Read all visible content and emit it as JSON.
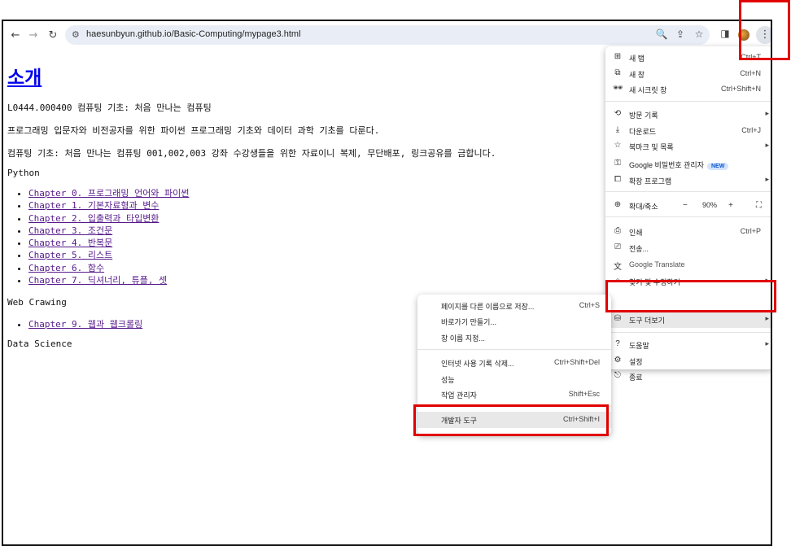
{
  "browser": {
    "url": "haesunbyun.github.io/Basic-Computing/mypage3.html",
    "icons": {
      "back": "←",
      "forward": "→",
      "reload": "↻",
      "site_info": "⚙",
      "zoom": "🔍",
      "share": "⇪",
      "bookmark": "☆",
      "side_panel": "◨",
      "menu": "⋮"
    }
  },
  "page": {
    "title": "소개",
    "lines": [
      "L0444.000400 컴퓨팅 기초: 처음 만나는 컴퓨팅",
      "프로그래밍 입문자와 비전공자를 위한 파이썬 프로그래밍 기초와 데이터 과학 기초를 다룬다.",
      "컴퓨팅 기초: 처음 만나는 컴퓨팅 001,002,003 강좌 수강생들을 위한 자료이니 복제, 무단배포, 링크공유를 금합니다."
    ],
    "sections": [
      {
        "heading": "Python",
        "links": [
          "Chapter 0. 프로그래밍 언어와 파이썬",
          "Chapter 1. 기본자료형과 변수",
          "Chapter 2. 입출력과 타입변환",
          "Chapter 3. 조건문",
          "Chapter 4. 반복문",
          "Chapter 5. 리스트",
          "Chapter 6. 함수",
          "Chapter 7. 딕셔너리, 튜플, 셋"
        ]
      },
      {
        "heading": "Web Crawing",
        "links": [
          "Chapter 9. 웹과 웹크롤링"
        ]
      },
      {
        "heading": "Data Science",
        "links": []
      }
    ]
  },
  "menu": {
    "items": [
      {
        "icon": "⊞",
        "label": "새 탭",
        "shortcut": "Ctrl+T"
      },
      {
        "icon": "⧉",
        "label": "새 창",
        "shortcut": "Ctrl+N"
      },
      {
        "icon": "🕶",
        "label": "새 시크릿 창",
        "shortcut": "Ctrl+Shift+N"
      },
      {
        "icon": "⟲",
        "label": "방문 기록",
        "arrow": "▸"
      },
      {
        "icon": "⤓",
        "label": "다운로드",
        "shortcut": "Ctrl+J"
      },
      {
        "icon": "☆",
        "label": "북마크 및 목록",
        "arrow": "▸"
      },
      {
        "icon": "⚿",
        "label": "Google 비밀번호 관리자",
        "badge": "NEW"
      },
      {
        "icon": "⧠",
        "label": "확장 프로그램",
        "arrow": "▸"
      },
      {
        "icon": "⊕",
        "label": "확대/축소",
        "zoom_minus": "−",
        "zoom_value": "90%",
        "zoom_plus": "+",
        "fullscreen": "⛶"
      },
      {
        "icon": "⎙",
        "label": "인쇄",
        "shortcut": "Ctrl+P"
      },
      {
        "icon": "⎚",
        "label": "전송..."
      },
      {
        "icon": "文",
        "label": "Google Translate"
      },
      {
        "icon": "⌕",
        "label": "찾기 및 수정하기",
        "arrow": "▸"
      },
      {
        "icon": "⛁",
        "label": "도구 더보기",
        "arrow": "▸"
      },
      {
        "icon": "?",
        "label": "도움말",
        "arrow": "▸"
      },
      {
        "icon": "⚙",
        "label": "설정"
      },
      {
        "icon": "⎋",
        "label": "종료"
      }
    ]
  },
  "submenu": {
    "items": [
      {
        "label": "페이지를 다른 이름으로 저장...",
        "shortcut": "Ctrl+S"
      },
      {
        "label": "바로가기 만들기..."
      },
      {
        "label": "창 이름 지정..."
      },
      {
        "label": "인터넷 사용 기록 삭제...",
        "shortcut": "Ctrl+Shift+Del"
      },
      {
        "label": "성능"
      },
      {
        "label": "작업 관리자",
        "shortcut": "Shift+Esc"
      },
      {
        "label": "개발자 도구",
        "shortcut": "Ctrl+Shift+I"
      }
    ]
  },
  "colors": {
    "highlight_box": "#e10000",
    "link": "#0000ee",
    "visited_link": "#551a8b"
  }
}
